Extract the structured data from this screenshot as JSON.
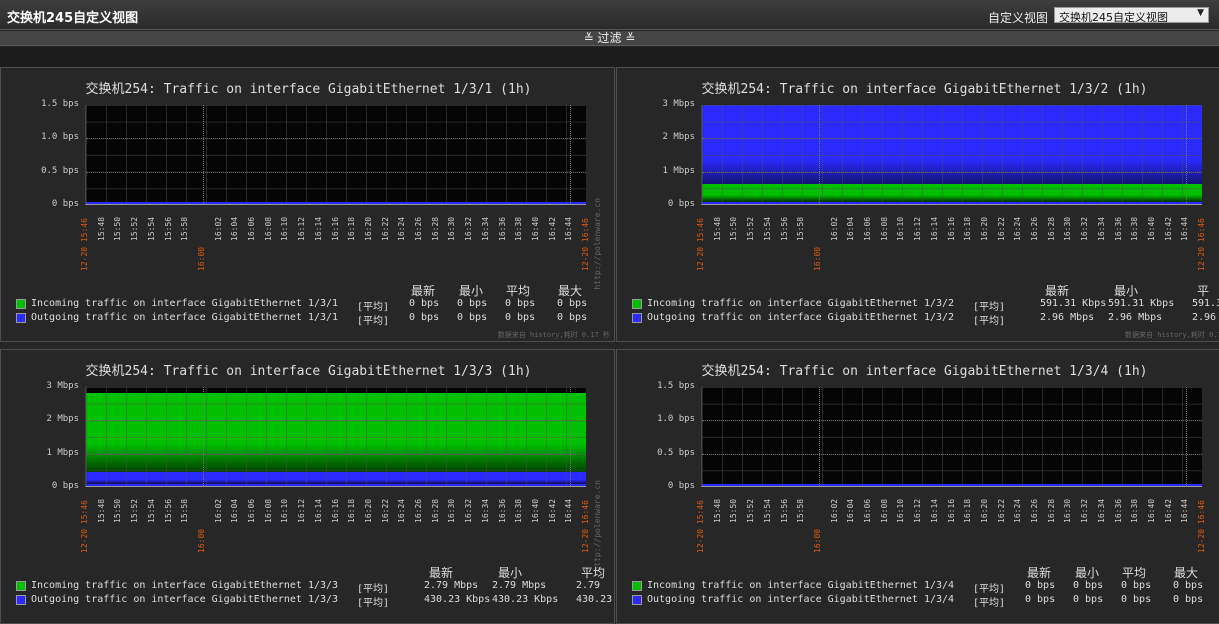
{
  "header": {
    "title": "交换机245自定义视图",
    "view_label": "自定义视图",
    "view_selected": "交换机245自定义视图",
    "filter_label": "≚ 过滤 ≚"
  },
  "legend_headers": {
    "avg_tag": "[平均]",
    "last": "最新",
    "min": "最小",
    "avg": "平均",
    "max": "最大"
  },
  "colors": {
    "incoming": "#00c000",
    "outgoing": "#2a2aff"
  },
  "panels": [
    {
      "title": "交换机254: Traffic on interface GigabitEthernet 1/3/1 (1h)",
      "y_ticks": [
        "1.5 bps",
        "1.0 bps",
        "0.5 bps",
        "0 bps"
      ],
      "incoming": {
        "label": "Incoming traffic on interface GigabitEthernet 1/3/1",
        "last": "0 bps",
        "min": "0 bps",
        "avg": "0 bps",
        "max": "0 bps"
      },
      "outgoing": {
        "label": "Outgoing traffic on interface GigabitEthernet 1/3/1",
        "last": "0 bps",
        "min": "0 bps",
        "avg": "0 bps",
        "max": "0 bps"
      },
      "footnote": "数据来自 history,耗时 0.17 秒",
      "side_text": "http://polenware.cn"
    },
    {
      "title": "交换机254: Traffic on interface GigabitEthernet 1/3/2 (1h)",
      "y_ticks": [
        "3 Mbps",
        "2 Mbps",
        "1 Mbps",
        "0 bps"
      ],
      "incoming": {
        "label": "Incoming traffic on interface GigabitEthernet 1/3/2",
        "last": "591.31 Kbps",
        "min": "591.31 Kbps",
        "avg": "591.3"
      },
      "outgoing": {
        "label": "Outgoing traffic on interface GigabitEthernet 1/3/2",
        "last": "2.96 Mbps",
        "min": "2.96 Mbps",
        "avg": "2.96"
      },
      "avg_header": "平",
      "footnote": "数据来自 history,耗时 0.12"
    },
    {
      "title": "交换机254: Traffic on interface GigabitEthernet 1/3/3 (1h)",
      "y_ticks": [
        "3 Mbps",
        "2 Mbps",
        "1 Mbps",
        "0 bps"
      ],
      "incoming": {
        "label": "Incoming traffic on interface GigabitEthernet 1/3/3",
        "last": "2.79 Mbps",
        "min": "2.79 Mbps",
        "avg": "2.79"
      },
      "outgoing": {
        "label": "Outgoing traffic on interface GigabitEthernet 1/3/3",
        "last": "430.23 Kbps",
        "min": "430.23 Kbps",
        "avg": "430.23"
      },
      "avg_header": "平均",
      "side_text": "http://polenware.cn"
    },
    {
      "title": "交换机254: Traffic on interface GigabitEthernet 1/3/4 (1h)",
      "y_ticks": [
        "1.5 bps",
        "1.0 bps",
        "0.5 bps",
        "0 bps"
      ],
      "incoming": {
        "label": "Incoming traffic on interface GigabitEthernet 1/3/4",
        "last": "0 bps",
        "min": "0 bps",
        "avg": "0 bps",
        "max": "0 bps"
      },
      "outgoing": {
        "label": "Outgoing traffic on interface GigabitEthernet 1/3/4",
        "last": "0 bps",
        "min": "0 bps",
        "avg": "0 bps",
        "max": "0 bps"
      }
    }
  ],
  "x_ticks": [
    "12-20 15:46",
    "15:48",
    "15:50",
    "15:52",
    "15:54",
    "15:56",
    "15:58",
    "16:00",
    "16:02",
    "16:04",
    "16:06",
    "16:08",
    "16:10",
    "16:12",
    "16:14",
    "16:16",
    "16:18",
    "16:20",
    "16:22",
    "16:24",
    "16:26",
    "16:28",
    "16:30",
    "16:32",
    "16:34",
    "16:36",
    "16:38",
    "16:40",
    "16:42",
    "16:44",
    "12-20 16:46"
  ],
  "x_tick_red": [
    0,
    7,
    30
  ],
  "chart_data": [
    {
      "type": "area",
      "title": "交换机254: Traffic on interface GigabitEthernet 1/3/1 (1h)",
      "ylim": [
        0,
        1.5
      ],
      "series": [
        {
          "name": "Incoming traffic on interface GigabitEthernet 1/3/1",
          "values": [
            0
          ]
        },
        {
          "name": "Outgoing traffic on interface GigabitEthernet 1/3/1",
          "values": [
            0
          ]
        }
      ]
    },
    {
      "type": "area",
      "title": "交换机254: Traffic on interface GigabitEthernet 1/3/2 (1h)",
      "ylim": [
        0,
        3
      ],
      "series": [
        {
          "name": "Incoming traffic on interface GigabitEthernet 1/3/2",
          "values": [
            0.59131
          ]
        },
        {
          "name": "Outgoing traffic on interface GigabitEthernet 1/3/2",
          "values": [
            2.96
          ]
        }
      ]
    },
    {
      "type": "area",
      "title": "交换机254: Traffic on interface GigabitEthernet 1/3/3 (1h)",
      "ylim": [
        0,
        3
      ],
      "series": [
        {
          "name": "Incoming traffic on interface GigabitEthernet 1/3/3",
          "values": [
            2.79
          ]
        },
        {
          "name": "Outgoing traffic on interface GigabitEthernet 1/3/3",
          "values": [
            0.43023
          ]
        }
      ]
    },
    {
      "type": "area",
      "title": "交换机254: Traffic on interface GigabitEthernet 1/3/4 (1h)",
      "ylim": [
        0,
        1.5
      ],
      "series": [
        {
          "name": "Incoming traffic on interface GigabitEthernet 1/3/4",
          "values": [
            0
          ]
        },
        {
          "name": "Outgoing traffic on interface GigabitEthernet 1/3/4",
          "values": [
            0
          ]
        }
      ]
    }
  ]
}
